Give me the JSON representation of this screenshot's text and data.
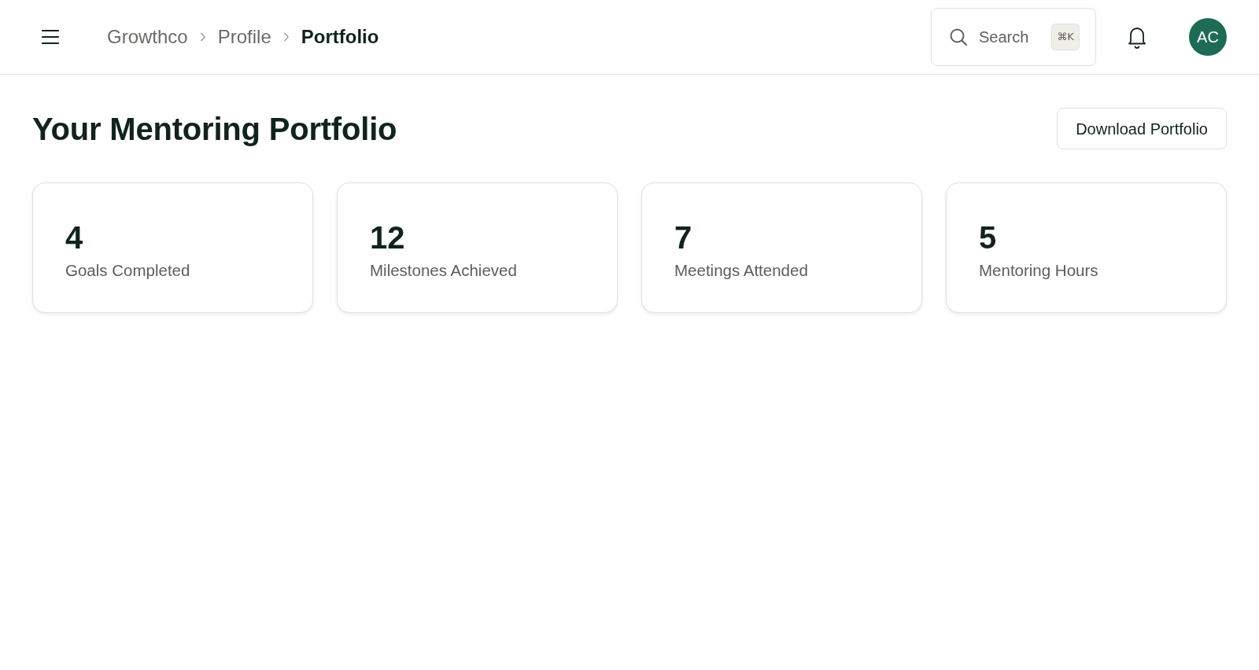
{
  "header": {
    "breadcrumbs": [
      {
        "label": "Growthco",
        "current": false
      },
      {
        "label": "Profile",
        "current": false
      },
      {
        "label": "Portfolio",
        "current": true
      }
    ],
    "search": {
      "placeholder": "Search",
      "shortcut": "⌘K"
    },
    "avatar": {
      "initials": "AC"
    }
  },
  "page": {
    "title": "Your Mentoring Portfolio",
    "action": "Download Portfolio"
  },
  "stats": [
    {
      "value": "4",
      "label": "Goals Completed"
    },
    {
      "value": "12",
      "label": "Milestones Achieved"
    },
    {
      "value": "7",
      "label": "Meetings Attended"
    },
    {
      "value": "5",
      "label": "Mentoring Hours"
    }
  ]
}
